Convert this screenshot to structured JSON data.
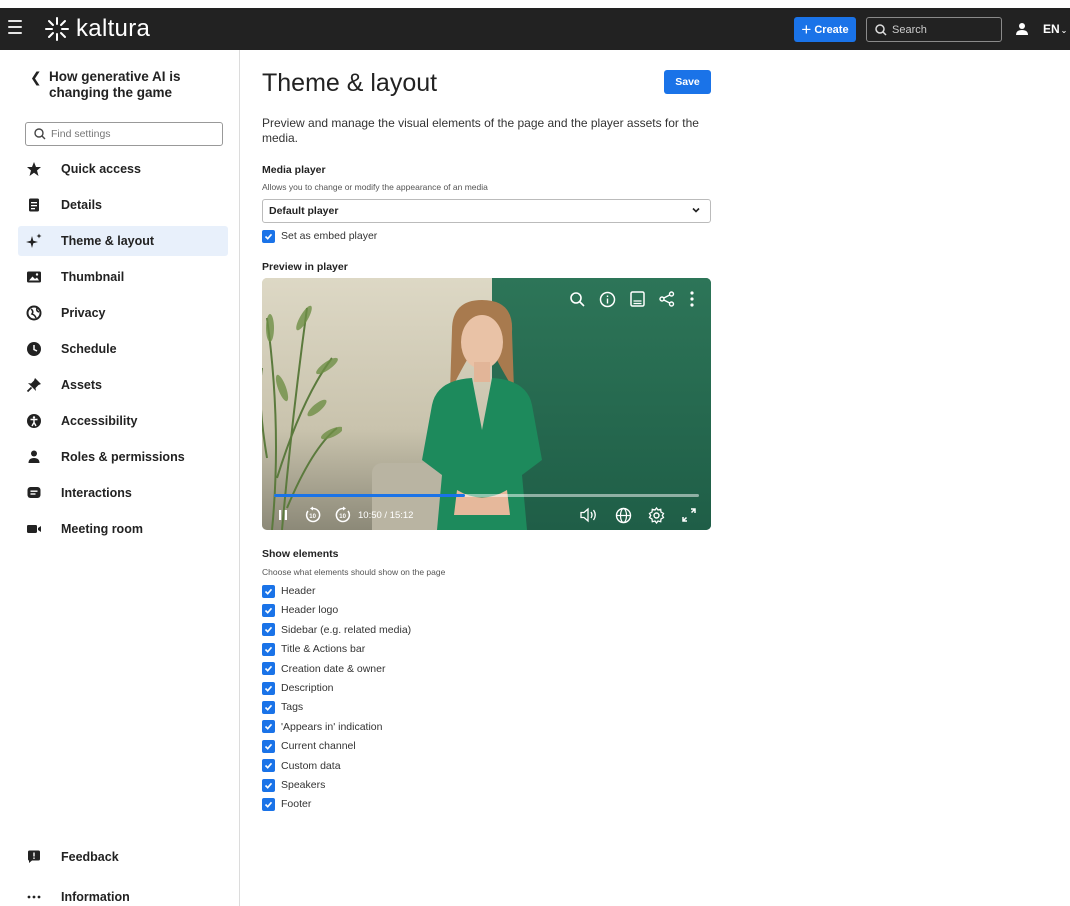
{
  "header": {
    "logo_text": "kaltura",
    "create_label": "Create",
    "search_placeholder": "Search",
    "lang": "EN",
    "accent": "#1a73e8",
    "bar_color": "#222222"
  },
  "sidebar": {
    "back_icon": "chevron-left-icon",
    "media_title": "How generative AI is changing the game",
    "find_placeholder": "Find settings",
    "items": [
      {
        "label": "Quick access",
        "icon": "star-icon"
      },
      {
        "label": "Details",
        "icon": "document-icon"
      },
      {
        "label": "Theme & layout",
        "icon": "sparkles-icon",
        "active": true
      },
      {
        "label": "Thumbnail",
        "icon": "image-icon"
      },
      {
        "label": "Privacy",
        "icon": "globe-icon"
      },
      {
        "label": "Schedule",
        "icon": "clock-icon"
      },
      {
        "label": "Assets",
        "icon": "pin-icon"
      },
      {
        "label": "Accessibility",
        "icon": "accessibility-icon"
      },
      {
        "label": "Roles & permissions",
        "icon": "person-icon"
      },
      {
        "label": "Interactions",
        "icon": "chat-icon"
      },
      {
        "label": "Meeting room",
        "icon": "video-camera-icon"
      }
    ],
    "footer": [
      {
        "label": "Feedback",
        "icon": "feedback-icon"
      },
      {
        "label": "Information",
        "icon": "more-dots-icon"
      }
    ]
  },
  "main": {
    "title": "Theme & layout",
    "save_label": "Save",
    "intro": "Preview and manage the visual elements of the page and the player assets for the media.",
    "media_player": {
      "title": "Media player",
      "desc": "Allows you to change or modify the appearance of an media",
      "selected": "Default player",
      "embed_label": "Set as embed player",
      "embed_checked": true
    },
    "preview": {
      "title": "Preview in player",
      "time": "10:50 / 15:12",
      "progress": 0.45
    },
    "show_elements": {
      "title": "Show elements",
      "desc": "Choose what elements should show on the page",
      "items": [
        {
          "label": "Header",
          "checked": true
        },
        {
          "label": "Header logo",
          "checked": true
        },
        {
          "label": "Sidebar (e.g. related media)",
          "checked": true
        },
        {
          "label": "Title & Actions bar",
          "checked": true
        },
        {
          "label": "Creation date & owner",
          "checked": true
        },
        {
          "label": "Description",
          "checked": true
        },
        {
          "label": "Tags",
          "checked": true
        },
        {
          "label": "'Appears in' indication",
          "checked": true
        },
        {
          "label": "Current channel",
          "checked": true
        },
        {
          "label": "Custom data",
          "checked": true
        },
        {
          "label": "Speakers",
          "checked": true
        },
        {
          "label": "Footer",
          "checked": true
        }
      ]
    }
  }
}
